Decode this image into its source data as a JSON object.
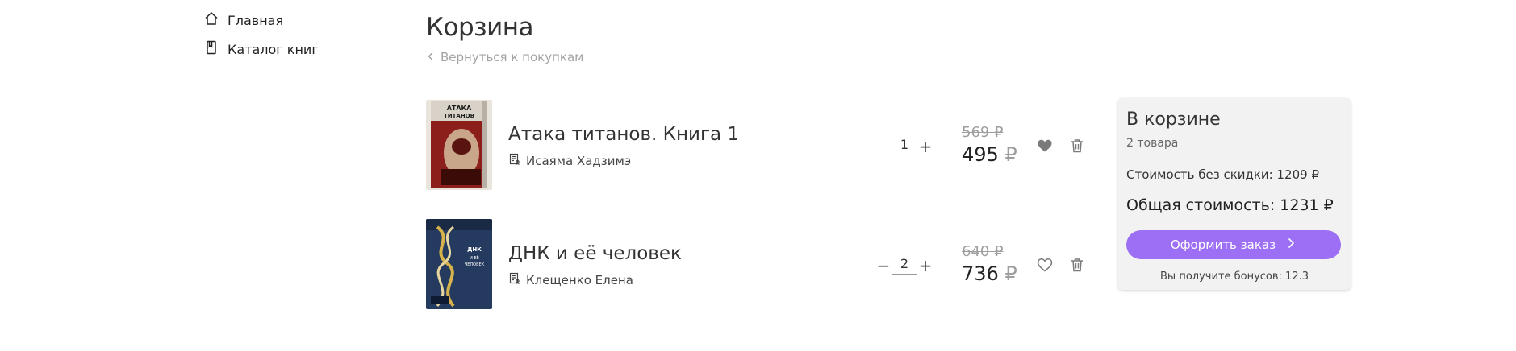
{
  "sidebar": {
    "items": [
      {
        "label": "Главная",
        "icon": "home-icon"
      },
      {
        "label": "Каталог книг",
        "icon": "book-icon"
      }
    ]
  },
  "header": {
    "title": "Корзина",
    "back_label": "Вернуться к покупкам"
  },
  "cart": {
    "items": [
      {
        "title": "Атака титанов. Книга 1",
        "author": "Исаяма Хадзимэ",
        "quantity": "1",
        "old_price": "569 ₽",
        "new_price": "495",
        "currency": "₽",
        "favorite": true,
        "cover_text": "АТАКА ТИТАНОВ"
      },
      {
        "title": "ДНК и её человек",
        "author": "Клещенко Елена",
        "quantity": "2",
        "old_price": "640 ₽",
        "new_price": "736",
        "currency": "₽",
        "favorite": false,
        "cover_text": "ДНК И ЕЁ ЧЕЛОВЕК"
      }
    ]
  },
  "summary": {
    "title": "В корзине",
    "count": "2 товара",
    "no_discount": "Стоимость без скидки: 1209 ₽",
    "total": "Общая стоимость: 1231 ₽",
    "checkout_label": "Оформить заказ",
    "bonus": "Вы получите бонусов: 12.3"
  },
  "colors": {
    "accent": "#9c6ff5",
    "panel": "#f2f2f2",
    "muted": "#9e9e9e"
  }
}
